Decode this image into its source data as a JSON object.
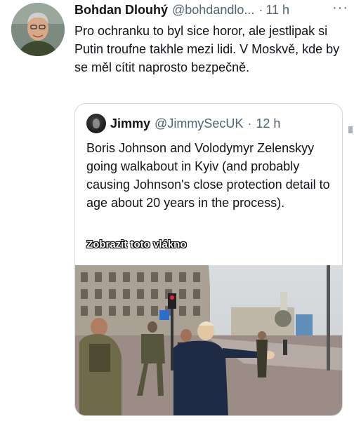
{
  "tweet": {
    "author_name": "Bohdan Dlouhý",
    "author_handle": "@bohdandlo...",
    "separator": "·",
    "time": "11 h",
    "more_icon": "ellipsis-icon",
    "text": "Pro ochranku to byl sice horor, ale jestlipak si Putin troufne takhle mezi lidi. V Moskvě, kde by se měl cítit naprosto bezpečně."
  },
  "quote": {
    "author_name": "Jimmy",
    "author_handle": "@JimmySecUK",
    "separator": "·",
    "time": "12 h",
    "text": "Boris Johnson and Volodymyr Zelenskyy going walkabout in Kyiv (and probably causing Johnson's close protection detail to age about 20 years in the process).",
    "thread_link": "Zobrazit toto vlákno"
  },
  "colors": {
    "text_primary": "#0f1419",
    "text_secondary": "#536471",
    "border": "#cfd9de"
  }
}
